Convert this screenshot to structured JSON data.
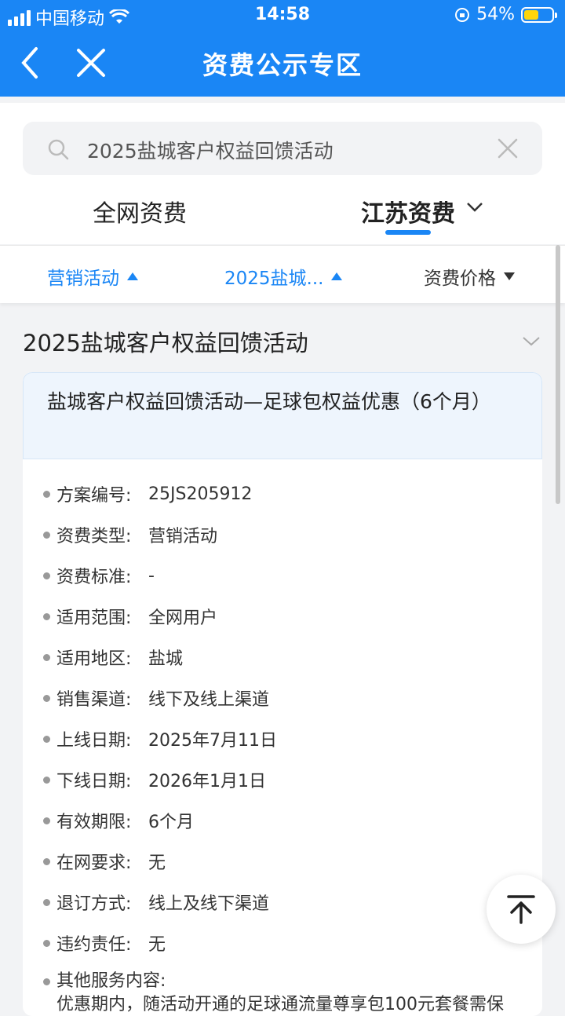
{
  "status": {
    "carrier": "中国移动",
    "time": "14:58",
    "battery": "54%",
    "battery_level": 0.54
  },
  "navbar": {
    "title": "资费公示专区"
  },
  "search": {
    "query": "2025盐城客户权益回馈活动"
  },
  "tabs": [
    {
      "label": "全网资费"
    },
    {
      "label": "江苏资费"
    }
  ],
  "filters": [
    {
      "label": "营销活动"
    },
    {
      "label": "2025盐城..."
    },
    {
      "label": "资费价格"
    }
  ],
  "section": {
    "title": "2025盐城客户权益回馈活动"
  },
  "card": {
    "title": "盐城客户权益回馈活动—足球包权益优惠（6个月）",
    "fields": [
      {
        "key": "方案编号:",
        "value": "25JS205912"
      },
      {
        "key": "资费类型:",
        "value": "营销活动"
      },
      {
        "key": "资费标准:",
        "value": "-"
      },
      {
        "key": "适用范围:",
        "value": "全网用户"
      },
      {
        "key": "适用地区:",
        "value": "盐城"
      },
      {
        "key": "销售渠道:",
        "value": "线下及线上渠道"
      },
      {
        "key": "上线日期:",
        "value": "2025年7月11日"
      },
      {
        "key": "下线日期:",
        "value": "2026年1月1日"
      },
      {
        "key": "有效期限:",
        "value": "6个月"
      },
      {
        "key": "在网要求:",
        "value": "无"
      },
      {
        "key": "退订方式:",
        "value": "线上及线下渠道"
      },
      {
        "key": "违约责任:",
        "value": "无"
      }
    ],
    "other_label": "其他服务内容:",
    "other_text": "优惠期内，随活动开通的足球通流量尊享包100元套餐需保"
  },
  "colors": {
    "brand": "#1a86f5"
  }
}
